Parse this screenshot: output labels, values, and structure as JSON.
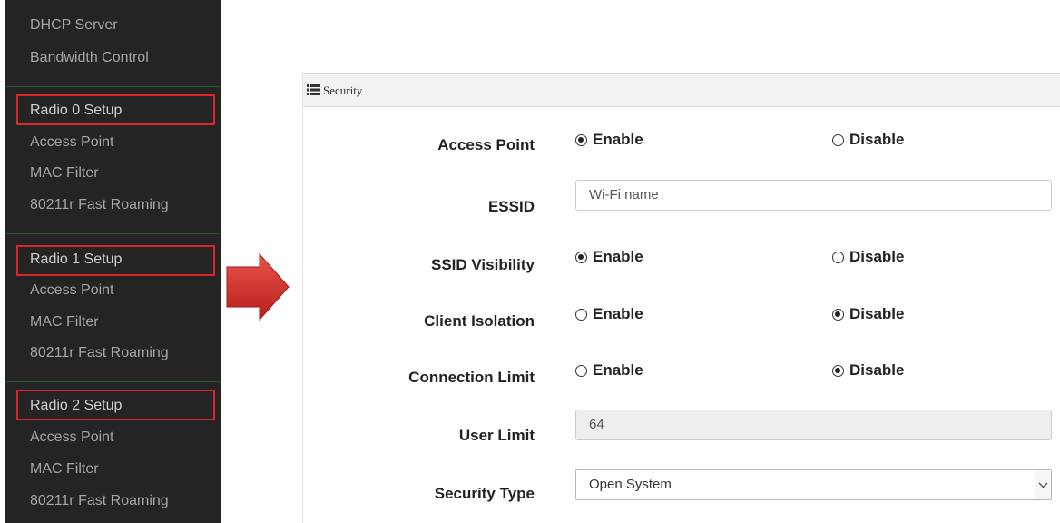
{
  "sidebar": {
    "items": [
      {
        "label": "DHCP Server"
      },
      {
        "label": "Bandwidth Control"
      },
      {
        "label": "Radio 0 Setup"
      },
      {
        "label": "Access Point"
      },
      {
        "label": "MAC Filter"
      },
      {
        "label": "80211r Fast Roaming"
      },
      {
        "label": "Radio 1 Setup"
      },
      {
        "label": "Access Point"
      },
      {
        "label": "MAC Filter"
      },
      {
        "label": "80211r Fast Roaming"
      },
      {
        "label": "Radio 2 Setup"
      },
      {
        "label": "Access Point"
      },
      {
        "label": "MAC Filter"
      },
      {
        "label": "80211r Fast Roaming"
      }
    ]
  },
  "panel": {
    "title": "Security",
    "access_point": {
      "label": "Access Point",
      "enable": "Enable",
      "disable": "Disable",
      "selected": "enable"
    },
    "essid": {
      "label": "ESSID",
      "value": "Wi-Fi name"
    },
    "ssid_visibility": {
      "label": "SSID Visibility",
      "enable": "Enable",
      "disable": "Disable",
      "selected": "enable"
    },
    "client_isolation": {
      "label": "Client Isolation",
      "enable": "Enable",
      "disable": "Disable",
      "selected": "disable"
    },
    "connection_limit": {
      "label": "Connection Limit",
      "enable": "Enable",
      "disable": "Disable",
      "selected": "disable"
    },
    "user_limit": {
      "label": "User Limit",
      "value": "64"
    },
    "security_type": {
      "label": "Security Type",
      "value": "Open System"
    }
  },
  "colors": {
    "sidebar_bg": "#242424",
    "highlight": "#d8262b",
    "arrow": "#d4302c"
  }
}
